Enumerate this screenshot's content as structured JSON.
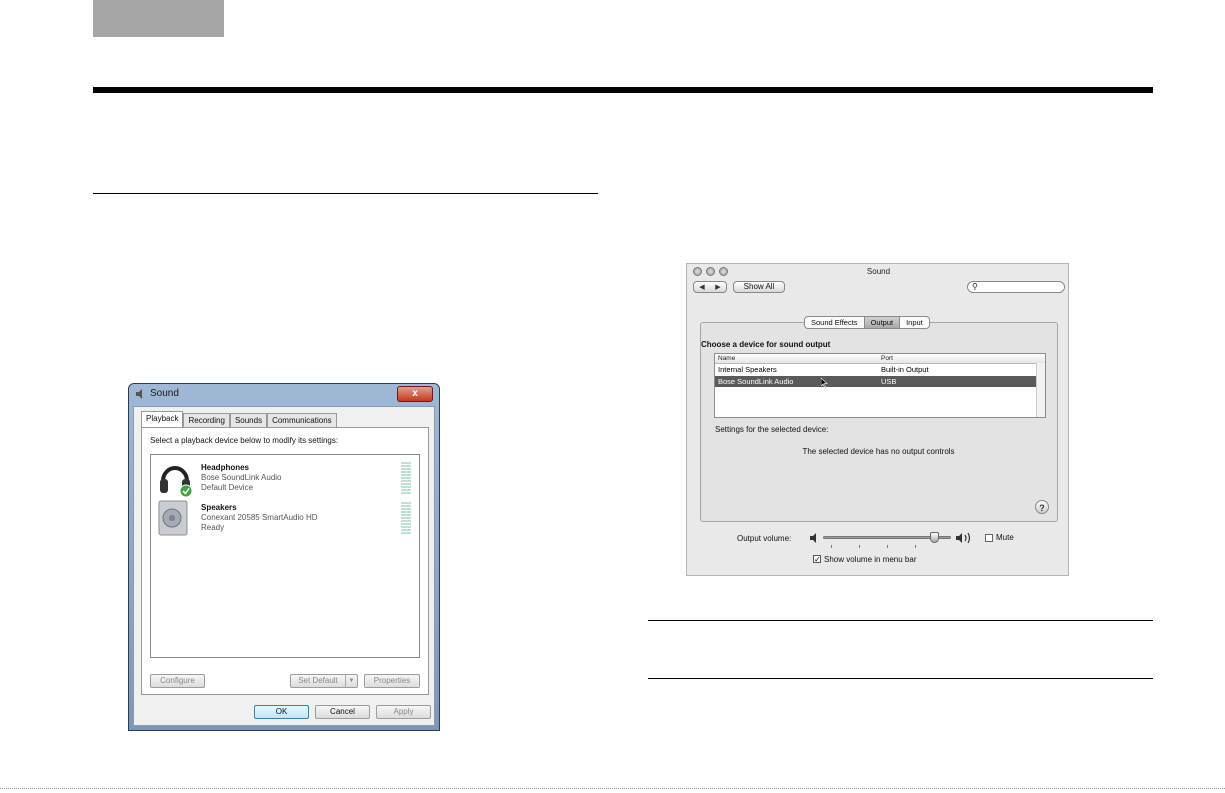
{
  "windows_dialog": {
    "title": "Sound",
    "close_label": "x",
    "tabs": [
      "Playback",
      "Recording",
      "Sounds",
      "Communications"
    ],
    "instruction": "Select a playback device below to modify its settings:",
    "devices": [
      {
        "name": "Headphones",
        "detail": "Bose SoundLink Audio",
        "status": "Default Device",
        "icon": "headphones-icon",
        "default": true
      },
      {
        "name": "Speakers",
        "detail": "Conexant 20585 SmartAudio HD",
        "status": "Ready",
        "icon": "speaker-icon",
        "default": false
      }
    ],
    "buttons": {
      "configure": "Configure",
      "set_default": "Set Default",
      "properties": "Properties",
      "ok": "OK",
      "cancel": "Cancel",
      "apply": "Apply"
    }
  },
  "mac_dialog": {
    "title": "Sound",
    "show_all": "Show All",
    "search_placeholder": "",
    "tabs": [
      "Sound Effects",
      "Output",
      "Input"
    ],
    "active_tab": "Output",
    "choose_heading": "Choose a device for sound output",
    "columns": [
      "Name",
      "Port"
    ],
    "rows": [
      {
        "name": "Internal Speakers",
        "port": "Built-in Output",
        "selected": false
      },
      {
        "name": "Bose SoundLink Audio",
        "port": "USB",
        "selected": true
      }
    ],
    "settings_label": "Settings for the selected device:",
    "no_controls": "The selected device has no output controls",
    "help": "?",
    "output_volume_label": "Output volume:",
    "output_volume_level": 0.9,
    "mute_label": "Mute",
    "mute_checked": false,
    "show_volume_label": "Show volume in menu bar",
    "show_volume_checked": true
  }
}
